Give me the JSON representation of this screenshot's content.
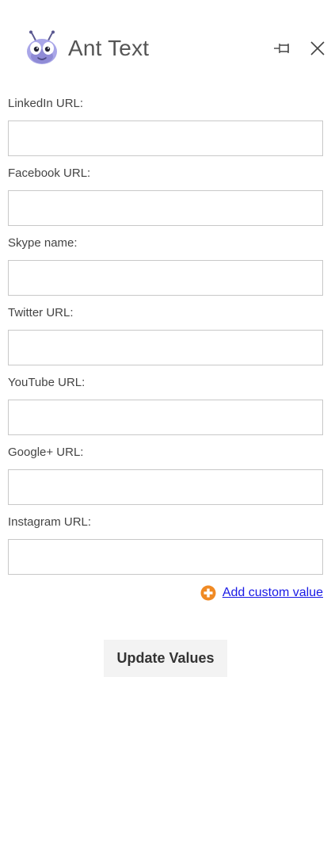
{
  "header": {
    "title": "Ant Text",
    "logo_icon": "ant-mascot-icon",
    "pin_icon": "pin-icon",
    "close_icon": "close-icon"
  },
  "form": {
    "fields": [
      {
        "label": "LinkedIn URL:",
        "value": "",
        "placeholder": ""
      },
      {
        "label": "Facebook URL:",
        "value": "",
        "placeholder": ""
      },
      {
        "label": "Skype name:",
        "value": "",
        "placeholder": ""
      },
      {
        "label": "Twitter URL:",
        "value": "",
        "placeholder": ""
      },
      {
        "label": "YouTube URL:",
        "value": "",
        "placeholder": ""
      },
      {
        "label": "Google+ URL:",
        "value": "",
        "placeholder": ""
      },
      {
        "label": "Instagram URL:",
        "value": "",
        "placeholder": ""
      }
    ]
  },
  "actions": {
    "add_custom_label": "Add custom value",
    "add_custom_icon": "plus-circle-icon",
    "update_label": "Update Values"
  },
  "colors": {
    "link": "#1a1ae6",
    "add_icon": "#f08a24",
    "mascot": "#a9a6e8"
  }
}
